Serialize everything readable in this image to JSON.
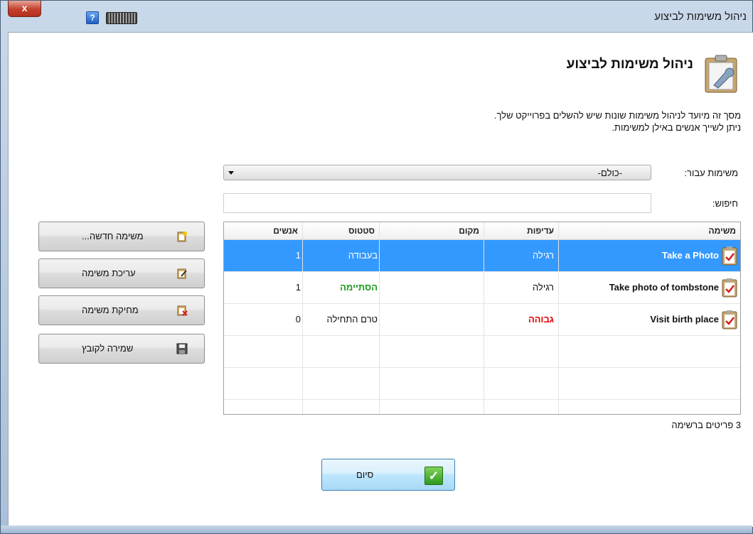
{
  "window": {
    "title": "ניהול משימות לביצוע",
    "close_label": "x",
    "help_label": "?"
  },
  "header": {
    "title": "ניהול משימות לביצוע",
    "description_line1": "מסך זה מיועד לניהול משימות שונות שיש להשלים בפרוייקט שלך.",
    "description_line2": "ניתן לשייך אנשים באילן למשימות."
  },
  "filter": {
    "label": "משימות עבור:",
    "selected": "-כולם-"
  },
  "search": {
    "label": "חיפוש:",
    "value": ""
  },
  "table": {
    "columns": [
      "משימה",
      "עדיפות",
      "מקום",
      "סטטוס",
      "אנשים"
    ],
    "rows": [
      {
        "task": "Take a Photo",
        "priority": "רגילה",
        "place": "",
        "status": "בעבודה",
        "people": "1",
        "selected": true
      },
      {
        "task": "Take photo of tombstone",
        "priority": "רגילה",
        "place": "",
        "status": "הסתיימה",
        "people": "1",
        "selected": false
      },
      {
        "task": "Visit birth place",
        "priority": "גבוהה",
        "place": "",
        "status": "טרם התחילה",
        "people": "0",
        "selected": false
      }
    ],
    "colors": {
      "done": "#1a9a1a",
      "high": "#e00000",
      "selected_bg": "#3399ff"
    }
  },
  "buttons": {
    "new": "משימה חדשה...",
    "edit": "עריכת משימה",
    "delete": "מחיקת משימה",
    "save": "שמירה לקובץ"
  },
  "count_text": "3 פריטים ברשימה",
  "finish_label": "סיום",
  "icons": [
    "close-icon",
    "help-icon",
    "keyboard-icon",
    "clipboard-wrench-icon",
    "clipboard-check-icon",
    "new-task-icon",
    "edit-task-icon",
    "delete-task-icon",
    "save-icon",
    "checkmark-icon"
  ]
}
